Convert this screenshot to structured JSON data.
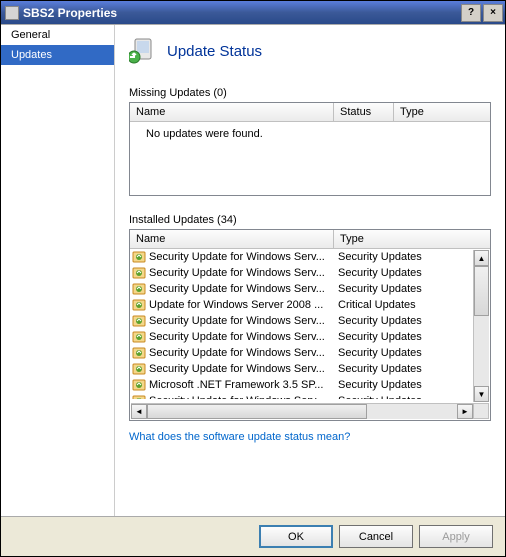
{
  "window": {
    "title": "SBS2 Properties",
    "help_btn": "?",
    "close_btn": "×"
  },
  "sidebar": {
    "items": [
      {
        "label": "General",
        "selected": false
      },
      {
        "label": "Updates",
        "selected": true
      }
    ]
  },
  "main": {
    "header": "Update Status",
    "missing": {
      "label": "Missing Updates (0)",
      "cols": {
        "name": "Name",
        "status": "Status",
        "type": "Type"
      },
      "empty_msg": "No updates were found."
    },
    "installed": {
      "label": "Installed Updates (34)",
      "cols": {
        "name": "Name",
        "type": "Type"
      },
      "rows": [
        {
          "name": "Security Update for Windows Serv...",
          "type": "Security Updates"
        },
        {
          "name": "Security Update for Windows Serv...",
          "type": "Security Updates"
        },
        {
          "name": "Security Update for Windows Serv...",
          "type": "Security Updates"
        },
        {
          "name": "Update for Windows Server 2008 ...",
          "type": "Critical Updates"
        },
        {
          "name": "Security Update for Windows Serv...",
          "type": "Security Updates"
        },
        {
          "name": "Security Update for Windows Serv...",
          "type": "Security Updates"
        },
        {
          "name": "Security Update for Windows Serv...",
          "type": "Security Updates"
        },
        {
          "name": "Security Update for Windows Serv...",
          "type": "Security Updates"
        },
        {
          "name": "Microsoft .NET Framework 3.5 SP...",
          "type": "Security Updates"
        },
        {
          "name": "Security Update for Windows Serv",
          "type": "Security Updates"
        }
      ]
    },
    "help_link": "What does the software update status mean?"
  },
  "footer": {
    "ok": "OK",
    "cancel": "Cancel",
    "apply": "Apply"
  }
}
